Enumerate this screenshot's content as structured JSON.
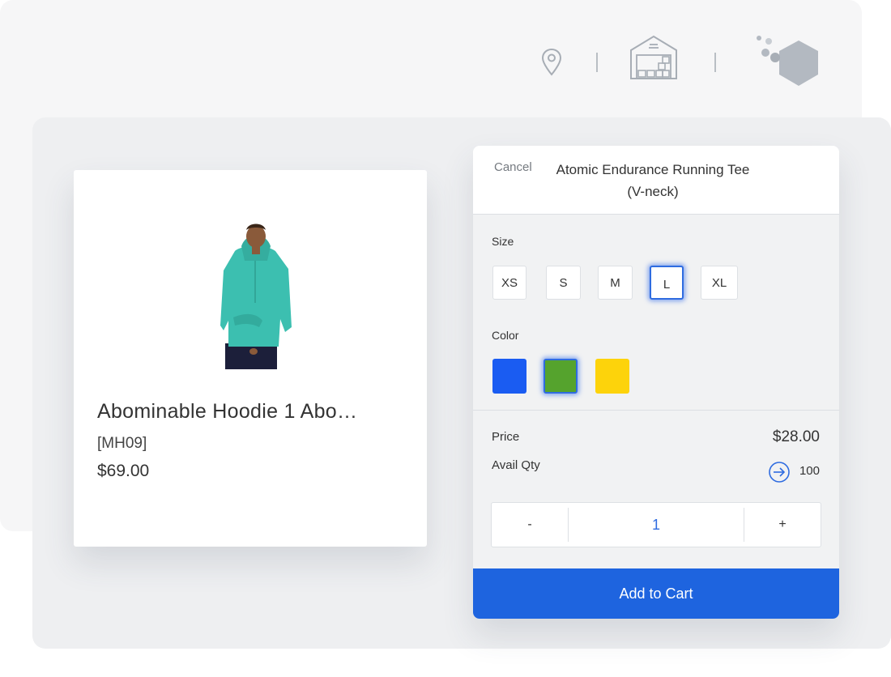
{
  "header_icons": {
    "location_icon": "map-pin-icon",
    "warehouse_icon": "warehouse-icon",
    "brand_icon": "hexagon-logo-icon"
  },
  "product_card": {
    "name": "Abominable Hoodie 1 Abo…",
    "sku": "[MH09]",
    "price": "$69.00",
    "image": "teal-hoodie-model-image"
  },
  "dialog": {
    "cancel_label": "Cancel",
    "title_line1": "Atomic Endurance Running Tee",
    "title_line2": "(V-neck)",
    "size_label": "Size",
    "sizes": [
      "XS",
      "S",
      "M",
      "L",
      "XL"
    ],
    "selected_size": "L",
    "color_label": "Color",
    "colors": [
      "#1a5cf2",
      "#55a32d",
      "#fdd30b"
    ],
    "selected_color": "#55a32d",
    "price_label": "Price",
    "price_value": "$28.00",
    "avail_qty_label": "Avail Qty",
    "avail_qty_value": "100",
    "qty_minus": "-",
    "qty_value": "1",
    "qty_plus": "+",
    "add_to_cart_label": "Add to Cart"
  },
  "colors": {
    "accent": "#1e64df",
    "selected_border": "#2f6ce0",
    "panel_back": "#f6f6f7",
    "panel_front": "#eeeff1",
    "hoodie": "#3cbfb0"
  }
}
